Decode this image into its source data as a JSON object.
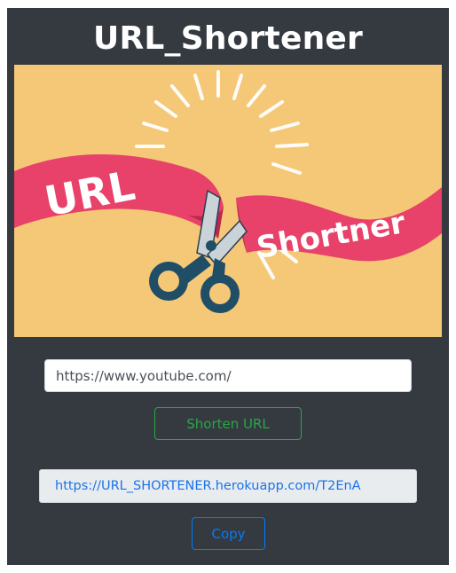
{
  "app": {
    "title": "URL_Shortener"
  },
  "banner": {
    "ribbon_left_text": "URL",
    "ribbon_right_text": "Shortner",
    "icon": "scissors-icon",
    "colors": {
      "background": "#f5c877",
      "ribbon": "#e8416a",
      "scissors": "#1f4e66"
    }
  },
  "form": {
    "url_value": "https://www.youtube.com/",
    "shorten_label": "Shorten URL"
  },
  "result": {
    "short_url": "https://URL_SHORTENER.herokuapp.com/T2EnA",
    "copy_label": "Copy"
  },
  "colors": {
    "card_background": "#343a40",
    "success": "#28a745",
    "primary": "#007bff",
    "link": "#1a73e8"
  }
}
